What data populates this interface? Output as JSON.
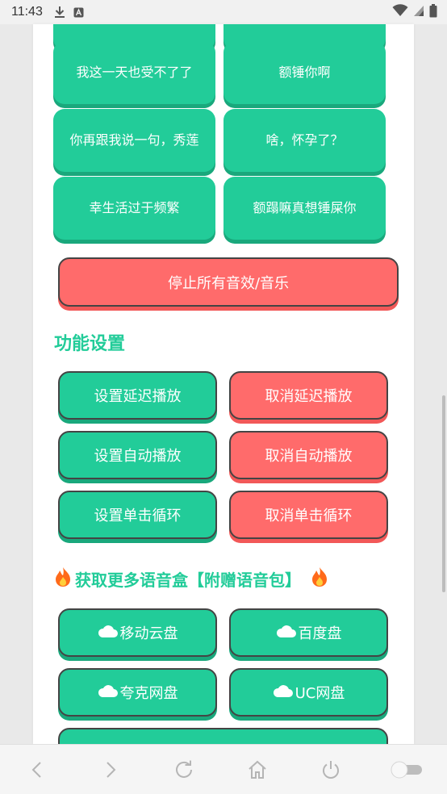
{
  "status": {
    "time": "11:43"
  },
  "sounds": [
    {
      "label": ""
    },
    {
      "label": ""
    },
    {
      "label": "我这一天也受不了了"
    },
    {
      "label": "额锤你啊"
    },
    {
      "label": "你再跟我说一句，秀莲"
    },
    {
      "label": "啥，怀孕了？"
    },
    {
      "label": "幸生活过于频繁"
    },
    {
      "label": "额蹋嘛真想锤屎你"
    }
  ],
  "stop_label": "停止所有音效/音乐",
  "settings": {
    "title": "功能设置",
    "set_delay": "设置延迟播放",
    "cancel_delay": "取消延迟播放",
    "set_auto": "设置自动播放",
    "cancel_auto": "取消自动播放",
    "set_loop": "设置单击循环",
    "cancel_loop": "取消单击循环"
  },
  "more": {
    "title": "获取更多语音盒【附赠语音包】",
    "clouds": [
      "移动云盘",
      "百度盘",
      "夸克网盘",
      "UC网盘"
    ]
  },
  "colors": {
    "accent": "#22cc99",
    "danger": "#ff6b6b",
    "border": "#444444"
  }
}
